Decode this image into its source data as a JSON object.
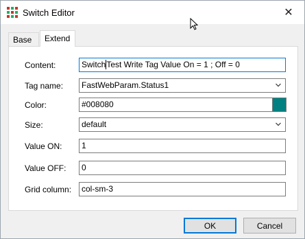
{
  "window": {
    "title": "Switch Editor",
    "close_glyph": "✕",
    "app_icon_colors": [
      "#c0392b",
      "#27ae60",
      "#c0392b",
      "#27ae60",
      "#c0392b",
      "#27ae60",
      "#c0392b",
      "#27ae60",
      "#c0392b"
    ]
  },
  "tabs": [
    {
      "label": "Base",
      "selected": false
    },
    {
      "label": "Extend",
      "selected": true
    }
  ],
  "form": {
    "content": {
      "label": "Content:",
      "value_before_caret": "Switch",
      "value_after_caret": "Test Write Tag Value On = 1 ; Off = 0"
    },
    "tag_name": {
      "label": "Tag name:",
      "value": "FastWebParam.Status1"
    },
    "color": {
      "label": "Color:",
      "value": "#008080",
      "swatch": "#008080"
    },
    "size": {
      "label": "Size:",
      "value": "default"
    },
    "value_on": {
      "label": "Value ON:",
      "value": "1"
    },
    "value_off": {
      "label": "Value OFF:",
      "value": "0"
    },
    "grid_column": {
      "label": "Grid column:",
      "value": "col-sm-3"
    }
  },
  "buttons": {
    "ok": "OK",
    "cancel": "Cancel"
  },
  "colors": {
    "focus_border": "#0078d7",
    "window_bg": "#f0f0f0"
  }
}
